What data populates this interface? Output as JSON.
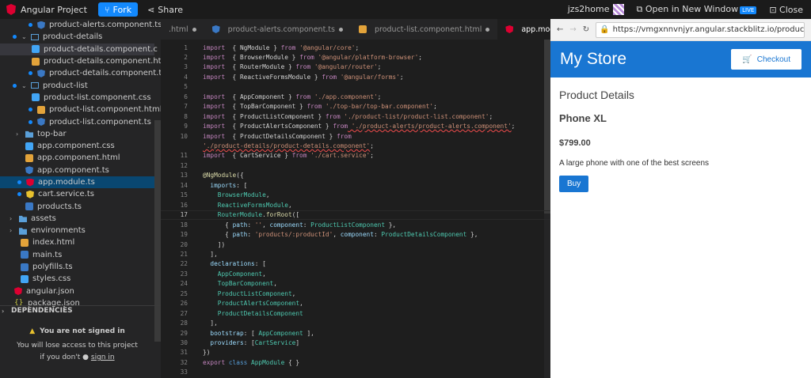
{
  "topbar": {
    "project": "Angular Project",
    "fork": "Fork",
    "share": "Share",
    "user": "jzs2home",
    "open_new": "Open in New Window",
    "live": "LIVE",
    "close": "Close"
  },
  "tree": [
    {
      "label": "product-alerts.component.ts",
      "icon": "ngts",
      "indent": 36,
      "dot": true
    },
    {
      "label": "product-details",
      "icon": "folder-open",
      "indent": 16,
      "dot": true,
      "chev": "⌄"
    },
    {
      "label": "product-details.component.c",
      "icon": "css",
      "indent": 40,
      "dot": false,
      "hl": true
    },
    {
      "label": "product-details.component.html",
      "icon": "html",
      "indent": 40,
      "dot": false
    },
    {
      "label": "product-details.component.ts",
      "icon": "ngts",
      "indent": 36,
      "dot": true
    },
    {
      "label": "product-list",
      "icon": "folder-open",
      "indent": 16,
      "dot": true,
      "chev": "⌄"
    },
    {
      "label": "product-list.component.css",
      "icon": "css",
      "indent": 40,
      "dot": false
    },
    {
      "label": "product-list.component.html",
      "icon": "html",
      "indent": 36,
      "dot": true
    },
    {
      "label": "product-list.component.ts",
      "icon": "ngts",
      "indent": 36,
      "dot": true
    },
    {
      "label": "top-bar",
      "icon": "folder",
      "indent": 20,
      "dot": false,
      "chev": "›"
    },
    {
      "label": "app.component.css",
      "icon": "css",
      "indent": 32,
      "dot": false
    },
    {
      "label": "app.component.html",
      "icon": "html",
      "indent": 32,
      "dot": false
    },
    {
      "label": "app.component.ts",
      "icon": "ngts",
      "indent": 32,
      "dot": false
    },
    {
      "label": "app.module.ts",
      "icon": "ng",
      "indent": 22,
      "dot": true,
      "selected": true
    },
    {
      "label": "cart.service.ts",
      "icon": "svc",
      "indent": 22,
      "dot": true
    },
    {
      "label": "products.ts",
      "icon": "ts",
      "indent": 32,
      "dot": false
    },
    {
      "label": "assets",
      "icon": "folder",
      "indent": 12,
      "dot": false,
      "chev": "›"
    },
    {
      "label": "environments",
      "icon": "folder",
      "indent": 12,
      "dot": false,
      "chev": "›"
    },
    {
      "label": "index.html",
      "icon": "html",
      "indent": 26,
      "dot": false
    },
    {
      "label": "main.ts",
      "icon": "ts",
      "indent": 26,
      "dot": false
    },
    {
      "label": "polyfills.ts",
      "icon": "ts",
      "indent": 26,
      "dot": false
    },
    {
      "label": "styles.css",
      "icon": "css",
      "indent": 26,
      "dot": false
    },
    {
      "label": "angular.json",
      "icon": "ng",
      "indent": 18,
      "dot": false
    },
    {
      "label": "package.json",
      "icon": "json",
      "indent": 18,
      "dot": false
    }
  ],
  "dependencies": "DEPENDENCIES",
  "signin": {
    "title": "You are not signed in",
    "line1": "You will lose access to this project",
    "line2a": "if you don't",
    "link": "sign in"
  },
  "tabs": [
    {
      "label": ".html",
      "icon": "",
      "active": false
    },
    {
      "label": "product-alerts.component.ts",
      "icon": "ngts",
      "active": false
    },
    {
      "label": "product-list.component.html",
      "icon": "html",
      "active": false
    },
    {
      "label": "app.module.ts",
      "icon": "ng",
      "active": true
    }
  ],
  "code": [
    [
      [
        "kw",
        "import"
      ],
      [
        "",
        "  { NgModule } "
      ],
      [
        "kw",
        "from"
      ],
      [
        "str",
        " '@angular/core'"
      ],
      [
        "",
        ";"
      ]
    ],
    [
      [
        "kw",
        "import"
      ],
      [
        "",
        "  { BrowserModule } "
      ],
      [
        "kw",
        "from"
      ],
      [
        "str",
        " '@angular/platform-browser'"
      ],
      [
        "",
        ";"
      ]
    ],
    [
      [
        "kw",
        "import"
      ],
      [
        "",
        "  { RouterModule } "
      ],
      [
        "kw",
        "from"
      ],
      [
        "str",
        " '@angular/router'"
      ],
      [
        "",
        ";"
      ]
    ],
    [
      [
        "kw",
        "import"
      ],
      [
        "",
        "  { ReactiveFormsModule } "
      ],
      [
        "kw",
        "from"
      ],
      [
        "str",
        " '@angular/forms'"
      ],
      [
        "",
        ";"
      ]
    ],
    [],
    [
      [
        "kw",
        "import"
      ],
      [
        "",
        "  { AppComponent } "
      ],
      [
        "kw",
        "from"
      ],
      [
        "str",
        " './app.component'"
      ],
      [
        "",
        ";"
      ]
    ],
    [
      [
        "kw",
        "import"
      ],
      [
        "",
        "  { TopBarComponent } "
      ],
      [
        "kw",
        "from"
      ],
      [
        "str",
        " './top-bar/top-bar.component'"
      ],
      [
        "",
        ";"
      ]
    ],
    [
      [
        "kw",
        "import"
      ],
      [
        "",
        "  { ProductListComponent } "
      ],
      [
        "kw",
        "from"
      ],
      [
        "str",
        " './product-list/product-list.component'"
      ],
      [
        "",
        ";"
      ]
    ],
    [
      [
        "kw",
        "import"
      ],
      [
        "",
        "  { ProductAlertsComponent } "
      ],
      [
        "kw",
        "from"
      ],
      [
        "str squig",
        " './product-alerts/product-alerts.component'"
      ],
      [
        "",
        ";"
      ]
    ],
    [
      [
        "kw",
        "import"
      ],
      [
        "",
        "  { ProductDetailsComponent } "
      ],
      [
        "kw",
        "from"
      ]
    ],
    [
      [
        "str squig",
        "'./product-details/product-details.component'"
      ],
      [
        "",
        ";"
      ]
    ],
    [
      [
        "kw",
        "import"
      ],
      [
        "",
        "  { CartService } "
      ],
      [
        "kw",
        "from"
      ],
      [
        "str",
        " './cart.service'"
      ],
      [
        "",
        ";"
      ]
    ],
    [],
    [
      [
        "dec",
        "@NgModule"
      ],
      [
        "",
        "({"
      ]
    ],
    [
      [
        "prop",
        "  imports"
      ],
      [
        "",
        ": ["
      ]
    ],
    [
      [
        "cls",
        "    BrowserModule"
      ],
      [
        "",
        ","
      ]
    ],
    [
      [
        "cls",
        "    ReactiveFormsModule"
      ],
      [
        "",
        ","
      ]
    ],
    [
      [
        "cls",
        "    RouterModule"
      ],
      [
        "",
        "."
      ],
      [
        "dec",
        "forRoot"
      ],
      [
        "",
        "(["
      ]
    ],
    [
      [
        "",
        "      { "
      ],
      [
        "prop",
        "path"
      ],
      [
        "",
        ": "
      ],
      [
        "str",
        "''"
      ],
      [
        "",
        ", "
      ],
      [
        "prop",
        "component"
      ],
      [
        "",
        ": "
      ],
      [
        "cls",
        "ProductListComponent"
      ],
      [
        "",
        " },"
      ]
    ],
    [
      [
        "",
        "      { "
      ],
      [
        "prop",
        "path"
      ],
      [
        "",
        ": "
      ],
      [
        "str",
        "'products/:productId'"
      ],
      [
        "",
        ", "
      ],
      [
        "prop",
        "component"
      ],
      [
        "",
        ": "
      ],
      [
        "cls",
        "ProductDetailsComponent"
      ],
      [
        "",
        " },"
      ]
    ],
    [
      [
        "",
        "    ])"
      ]
    ],
    [
      [
        "",
        "  ],"
      ]
    ],
    [
      [
        "prop",
        "  declarations"
      ],
      [
        "",
        ": ["
      ]
    ],
    [
      [
        "cls",
        "    AppComponent"
      ],
      [
        "",
        ","
      ]
    ],
    [
      [
        "cls",
        "    TopBarComponent"
      ],
      [
        "",
        ","
      ]
    ],
    [
      [
        "cls",
        "    ProductListComponent"
      ],
      [
        "",
        ","
      ]
    ],
    [
      [
        "cls",
        "    ProductAlertsComponent"
      ],
      [
        "",
        ","
      ]
    ],
    [
      [
        "cls",
        "    ProductDetailsComponent"
      ]
    ],
    [
      [
        "",
        "  ],"
      ]
    ],
    [
      [
        "prop",
        "  bootstrap"
      ],
      [
        "",
        ": [ "
      ],
      [
        "cls",
        "AppComponent"
      ],
      [
        "",
        " ],"
      ]
    ],
    [
      [
        "prop",
        "  providers"
      ],
      [
        "",
        ": ["
      ],
      [
        "cls",
        "CartService"
      ],
      [
        "",
        "]"
      ]
    ],
    [
      [
        "",
        "})"
      ]
    ],
    [
      [
        "kw",
        "export"
      ],
      [
        "kw2",
        " class "
      ],
      [
        "cls",
        "AppModule"
      ],
      [
        "",
        " { }"
      ]
    ],
    []
  ],
  "line_numbers": [
    "1",
    "2",
    "3",
    "4",
    "5",
    "6",
    "7",
    "8",
    "9",
    "10",
    "",
    "11",
    "12",
    "13",
    "14",
    "15",
    "16",
    "17",
    "18",
    "19",
    "20",
    "21",
    "22",
    "23",
    "24",
    "25",
    "26",
    "27",
    "28",
    "29",
    "30",
    "31",
    "32",
    "33"
  ],
  "current_line": "17",
  "preview": {
    "url": "https://vmgxnnvnjyr.angular.stackblitz.io/product...",
    "store_title": "My Store",
    "checkout": "Checkout",
    "heading": "Product Details",
    "product_name": "Phone XL",
    "price": "$799.00",
    "description": "A large phone with one of the best screens",
    "buy": "Buy"
  }
}
